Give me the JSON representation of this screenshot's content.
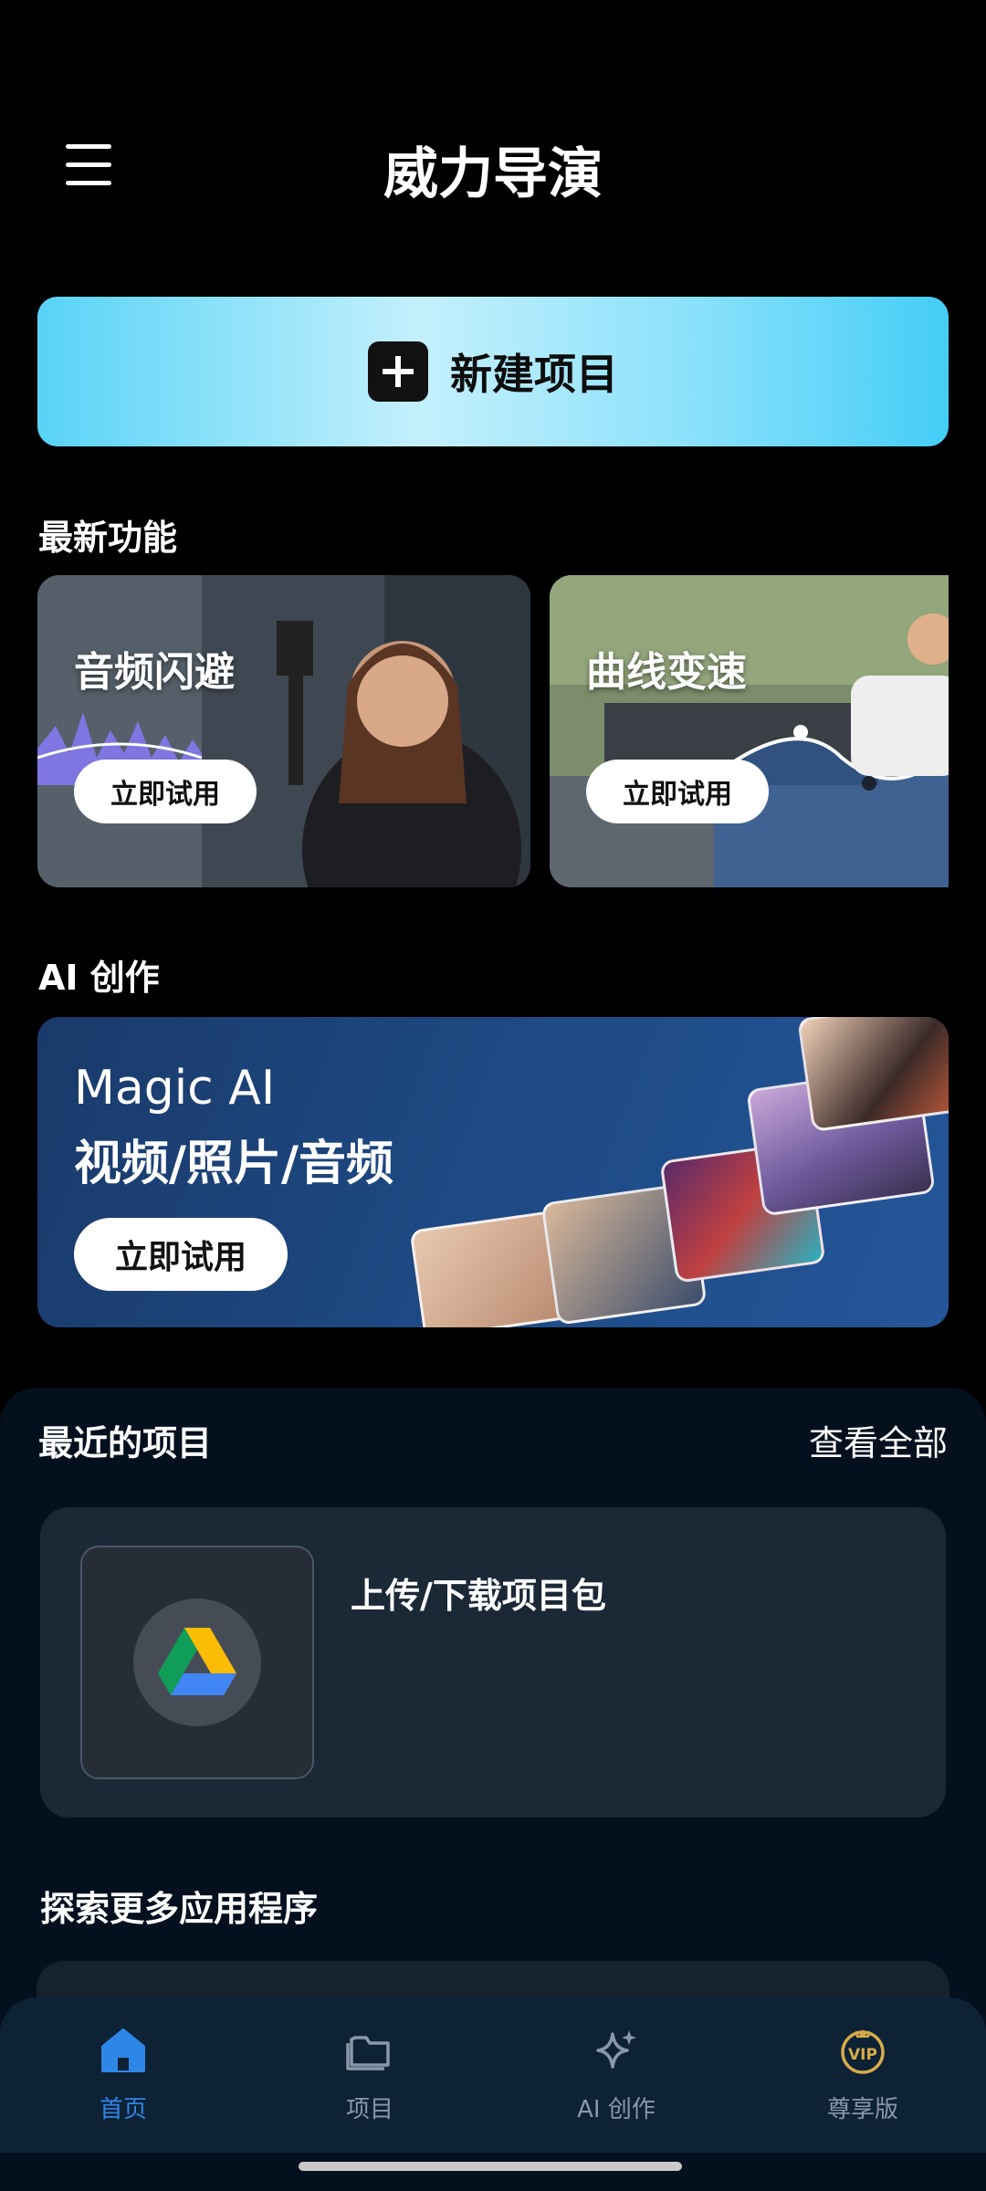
{
  "header": {
    "title": "威力导演"
  },
  "new_project": {
    "label": "新建项目"
  },
  "latest_features": {
    "title": "最新功能",
    "cards": [
      {
        "title": "音频闪避",
        "button": "立即试用"
      },
      {
        "title": "曲线变速",
        "button": "立即试用"
      }
    ]
  },
  "ai_section": {
    "title": "AI 创作",
    "banner_line1": "Magic AI",
    "banner_line2": "视频/照片/音频",
    "button": "立即试用"
  },
  "recent": {
    "title": "最近的项目",
    "view_all": "查看全部",
    "upload_label": "上传/下载项目包"
  },
  "explore": {
    "title": "探索更多应用程序"
  },
  "bottom_nav": {
    "items": [
      {
        "label": "首页",
        "icon": "home-icon",
        "active": true
      },
      {
        "label": "项目",
        "icon": "folder-icon",
        "active": false
      },
      {
        "label": "AI 创作",
        "icon": "sparkle-icon",
        "active": false
      },
      {
        "label": "尊享版",
        "icon": "vip-crown-icon",
        "active": false
      }
    ]
  },
  "colors": {
    "accent": "#2e86e6",
    "new_project_gradient_start": "#58d3f6",
    "panel_bg": "#04101e",
    "nav_bg": "#0e2236"
  }
}
